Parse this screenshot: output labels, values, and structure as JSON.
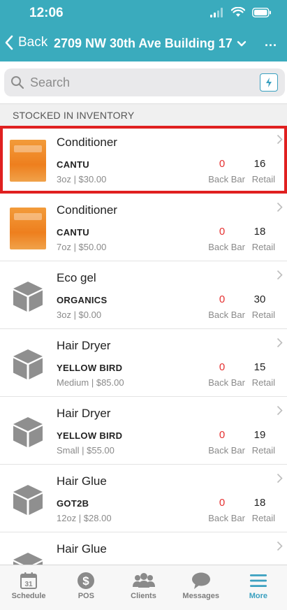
{
  "status_bar": {
    "time": "12:06"
  },
  "header": {
    "back_label": "Back",
    "title": "2709 NW 30th Ave Building 17",
    "more_label": "..."
  },
  "search": {
    "placeholder": "Search"
  },
  "section": {
    "label": "STOCKED IN INVENTORY"
  },
  "labels": {
    "back_bar": "Back Bar",
    "retail": "Retail"
  },
  "items": [
    {
      "name": "Conditioner",
      "brand": "CANTU",
      "detail": "3oz | $30.00",
      "back_bar": "0",
      "retail": "16",
      "image": "product",
      "selected": true
    },
    {
      "name": "Conditioner",
      "brand": "CANTU",
      "detail": "7oz | $50.00",
      "back_bar": "0",
      "retail": "18",
      "image": "product",
      "selected": false
    },
    {
      "name": "Eco gel",
      "brand": "ORGANICS",
      "detail": "3oz | $0.00",
      "back_bar": "0",
      "retail": "30",
      "image": "box-icon",
      "selected": false
    },
    {
      "name": "Hair Dryer",
      "brand": "YELLOW BIRD",
      "detail": "Medium | $85.00",
      "back_bar": "0",
      "retail": "15",
      "image": "box-icon",
      "selected": false
    },
    {
      "name": "Hair Dryer",
      "brand": "YELLOW BIRD",
      "detail": "Small | $55.00",
      "back_bar": "0",
      "retail": "19",
      "image": "box-icon",
      "selected": false
    },
    {
      "name": "Hair Glue",
      "brand": "GOT2B",
      "detail": "12oz | $28.00",
      "back_bar": "0",
      "retail": "18",
      "image": "box-icon",
      "selected": false
    },
    {
      "name": "Hair Glue",
      "brand": "",
      "detail": "",
      "back_bar": "",
      "retail": "",
      "image": "box-icon",
      "selected": false
    }
  ],
  "tabbar": {
    "tabs": [
      {
        "label": "Schedule",
        "icon": "calendar-icon",
        "calendar_day": "31",
        "active": false
      },
      {
        "label": "POS",
        "icon": "dollar-icon",
        "active": false
      },
      {
        "label": "Clients",
        "icon": "clients-icon",
        "active": false
      },
      {
        "label": "Messages",
        "icon": "messages-icon",
        "active": false
      },
      {
        "label": "More",
        "icon": "menu-icon",
        "active": true
      }
    ]
  },
  "colors": {
    "header": "#3aabbd",
    "accent": "#3aa0c0",
    "back_bar_value": "#e53030",
    "selection_outline": "#e02020"
  }
}
